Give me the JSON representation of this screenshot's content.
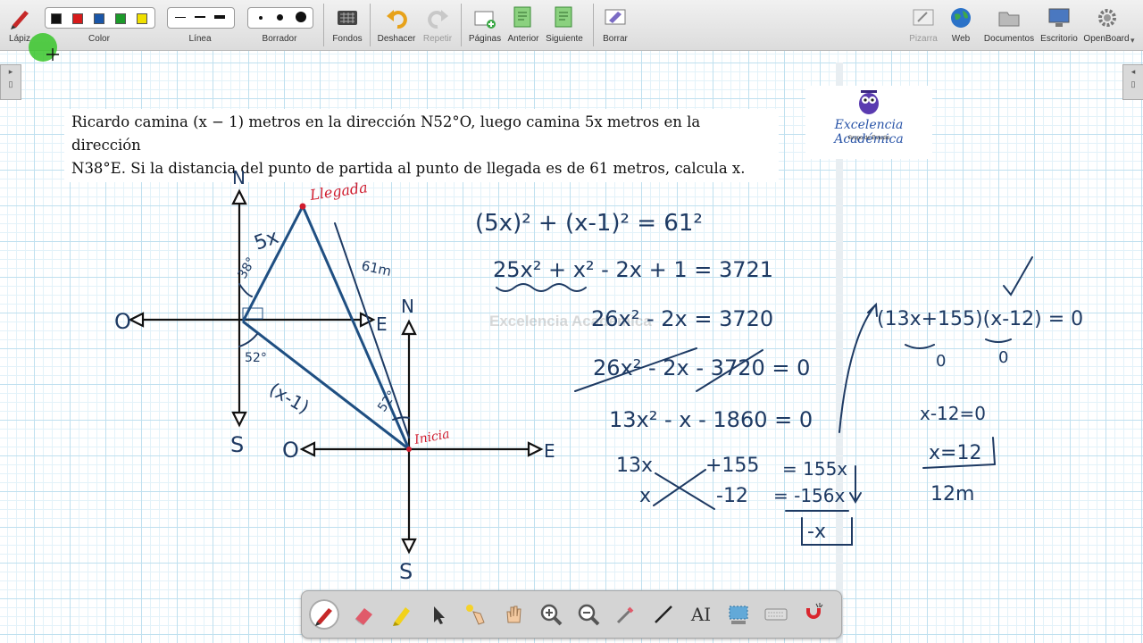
{
  "toolbar": {
    "lapiz": "Lápiz",
    "color": "Color",
    "linea": "Línea",
    "borrador": "Borrador",
    "fondos": "Fondos",
    "deshacer": "Deshacer",
    "repetir": "Repetir",
    "paginas": "Páginas",
    "anterior": "Anterior",
    "siguiente": "Siguiente",
    "borrar": "Borrar",
    "pizarra": "Pizarra",
    "web": "Web",
    "documentos": "Documentos",
    "escritorio": "Escritorio",
    "openboard": "OpenBoard",
    "colors": [
      "#111111",
      "#d81b1b",
      "#1a56a8",
      "#1c9a2a",
      "#f0e000"
    ]
  },
  "problem": {
    "line1": "Ricardo camina (x − 1) metros en la dirección N52°O, luego camina 5x metros en la dirección",
    "line2": "N38°E. Si la distancia del punto de partida al punto de llegada es de 61 metros, calcula x."
  },
  "logo": {
    "title": "Excelencia Académica",
    "subtitle": "Grupo de Estudio"
  },
  "watermark": "Excelencia Académica",
  "diagram": {
    "llegada": "Llegada",
    "inicia": "Inicia",
    "n": "N",
    "s": "S",
    "e": "E",
    "o": "O",
    "side_5x": "5x",
    "side_61": "61m",
    "side_x1": "(x-1)",
    "angle_38": "38°",
    "angle_52": "52°"
  },
  "work": {
    "eq1": "(5x)² + (x-1)² = 61²",
    "eq2": "25x² + x² - 2x + 1 = 3721",
    "eq3": "26x² - 2x = 3720",
    "eq4": "26x² - 2x - 3720 = 0",
    "eq5": "13x² - x - 1860 = 0",
    "fact_a": "13x",
    "fact_b": "+155",
    "fact_c": "x",
    "fact_d": "-12",
    "fact_e": "= 155x",
    "fact_f": "= -156x",
    "fact_sum": "-x",
    "factored": "(13x+155)(x-12) = 0",
    "zero1": "0",
    "zero2": "0",
    "sol1": "x-12=0",
    "sol2": "x=12",
    "answer": "12m"
  },
  "dock": {
    "tools": [
      "pen",
      "eraser",
      "highlighter",
      "pointer",
      "laser",
      "hand",
      "zoom-in",
      "zoom-out",
      "capture",
      "line",
      "text",
      "selector",
      "keyboard",
      "magnet"
    ],
    "text_tool": "AI"
  }
}
